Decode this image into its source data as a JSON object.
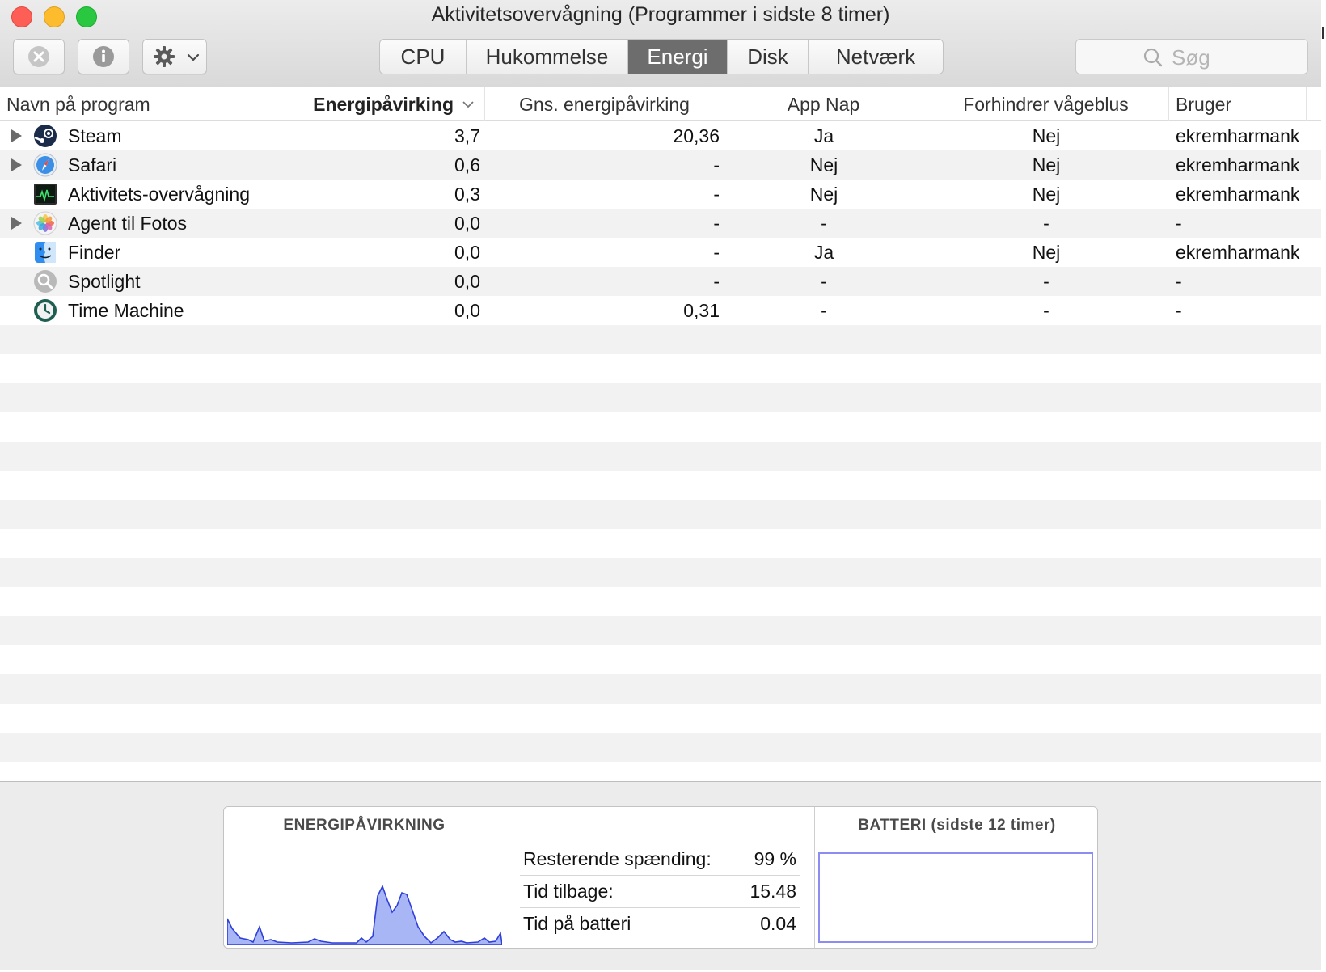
{
  "window": {
    "title": "Aktivitetsovervågning (Programmer i sidste 8 timer)"
  },
  "toolbar": {
    "stop_icon": "stop-process-icon",
    "info_icon": "info-icon",
    "gear_icon": "gear-icon",
    "tabs": [
      {
        "label": "CPU",
        "active": false
      },
      {
        "label": "Hukommelse",
        "active": false
      },
      {
        "label": "Energi",
        "active": true
      },
      {
        "label": "Disk",
        "active": false
      },
      {
        "label": "Netværk",
        "active": false
      }
    ],
    "search_placeholder": "Søg"
  },
  "table": {
    "columns": {
      "name": "Navn på program",
      "energy": "Energipåvirking",
      "avg": "Gns. energipåvirking",
      "app_nap": "App Nap",
      "prevent_sleep": "Forhindrer vågeblus",
      "user": "Bruger"
    },
    "rows": [
      {
        "expandable": true,
        "icon": "steam-icon",
        "name": "Steam",
        "energy": "3,7",
        "avg": "20,36",
        "app_nap": "Ja",
        "prevent_sleep": "Nej",
        "user": "ekremharmank"
      },
      {
        "expandable": true,
        "icon": "safari-icon",
        "name": "Safari",
        "energy": "0,6",
        "avg": "-",
        "app_nap": "Nej",
        "prevent_sleep": "Nej",
        "user": "ekremharmank"
      },
      {
        "expandable": false,
        "icon": "activity-monitor-icon",
        "name": "Aktivitets-overvågning",
        "energy": "0,3",
        "avg": "-",
        "app_nap": "Nej",
        "prevent_sleep": "Nej",
        "user": "ekremharmank"
      },
      {
        "expandable": true,
        "icon": "photos-icon",
        "name": "Agent til Fotos",
        "energy": "0,0",
        "avg": "-",
        "app_nap": "-",
        "prevent_sleep": "-",
        "user": "-"
      },
      {
        "expandable": false,
        "icon": "finder-icon",
        "name": "Finder",
        "energy": "0,0",
        "avg": "-",
        "app_nap": "Ja",
        "prevent_sleep": "Nej",
        "user": "ekremharmank"
      },
      {
        "expandable": false,
        "icon": "spotlight-icon",
        "name": "Spotlight",
        "energy": "0,0",
        "avg": "-",
        "app_nap": "-",
        "prevent_sleep": "-",
        "user": "-"
      },
      {
        "expandable": false,
        "icon": "time-machine-icon",
        "name": "Time Machine",
        "energy": "0,0",
        "avg": "0,31",
        "app_nap": "-",
        "prevent_sleep": "-",
        "user": "-"
      }
    ]
  },
  "summary": {
    "energy_title": "ENERGIPÅVIRKNING",
    "stats": [
      {
        "label": "Resterende spænding:",
        "value": "99 %"
      },
      {
        "label": "Tid tilbage:",
        "value": "15.48"
      },
      {
        "label": "Tid på batteri",
        "value": "0.04"
      }
    ],
    "battery_title": "BATTERI (sidste 12 timer)",
    "graph_color": "#2f3fd8",
    "graph_fill": "#a9b6f5"
  }
}
